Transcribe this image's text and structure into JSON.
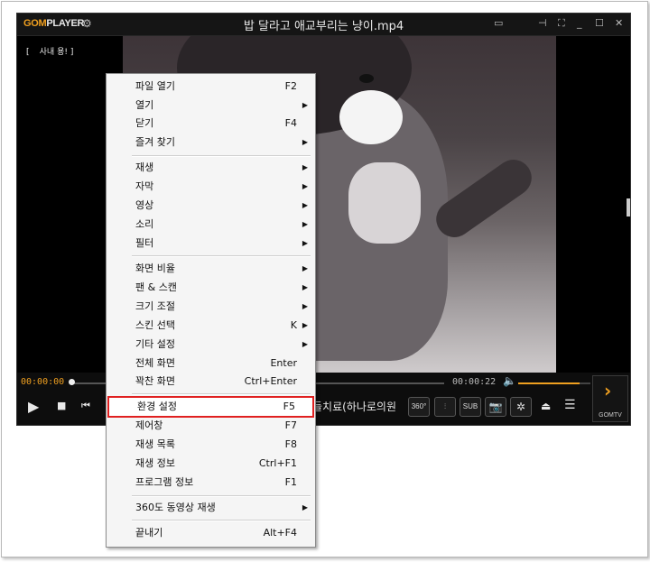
{
  "app": {
    "logo_gom": "GOM",
    "logo_player": "PLAYER",
    "window_title": "밥 달라고 애교부리는 냥이.mp4",
    "subtitle_badge": "[ ᅟ사내 용! ]"
  },
  "controls": {
    "time_elapsed": "00:00:00",
    "time_total": "00:00:22",
    "progress_fraction": 0.0,
    "volume_fraction": 0.85,
    "ticker_text": "들치료(하나로의원",
    "btn_360": "360°",
    "btn_sub": "SUB",
    "gomtv_label": "GOMTV"
  },
  "menu": {
    "items": [
      {
        "label": "파일 열기",
        "key": "F2",
        "submenu": false
      },
      {
        "label": "열기",
        "key": "",
        "submenu": true
      },
      {
        "label": "닫기",
        "key": "F4",
        "submenu": false
      },
      {
        "label": "즐겨 찾기",
        "key": "",
        "submenu": true
      },
      {
        "label": "재생",
        "key": "",
        "submenu": true
      },
      {
        "label": "자막",
        "key": "",
        "submenu": true
      },
      {
        "label": "영상",
        "key": "",
        "submenu": true
      },
      {
        "label": "소리",
        "key": "",
        "submenu": true
      },
      {
        "label": "필터",
        "key": "",
        "submenu": true
      },
      {
        "label": "화면 비율",
        "key": "",
        "submenu": true
      },
      {
        "label": "팬 & 스캔",
        "key": "",
        "submenu": true
      },
      {
        "label": "크기 조절",
        "key": "",
        "submenu": true
      },
      {
        "label": "스킨 선택",
        "key": "K",
        "submenu": true
      },
      {
        "label": "기타 설정",
        "key": "",
        "submenu": true
      },
      {
        "label": "전체 화면",
        "key": "Enter",
        "submenu": false
      },
      {
        "label": "꽉찬 화면",
        "key": "Ctrl+Enter",
        "submenu": false
      },
      {
        "label": "환경 설정",
        "key": "F5",
        "submenu": false,
        "highlighted": true
      },
      {
        "label": "제어창",
        "key": "F7",
        "submenu": false
      },
      {
        "label": "재생 목록",
        "key": "F8",
        "submenu": false
      },
      {
        "label": "재생 정보",
        "key": "Ctrl+F1",
        "submenu": false
      },
      {
        "label": "프로그램 정보",
        "key": "F1",
        "submenu": false
      },
      {
        "label": "360도 동영상 재생",
        "key": "",
        "submenu": true
      },
      {
        "label": "끝내기",
        "key": "Alt+F4",
        "submenu": false
      }
    ]
  },
  "colors": {
    "accent": "#f0a020",
    "highlight_border": "#e02020"
  },
  "icons": {
    "submenu_arrow": "▶"
  }
}
